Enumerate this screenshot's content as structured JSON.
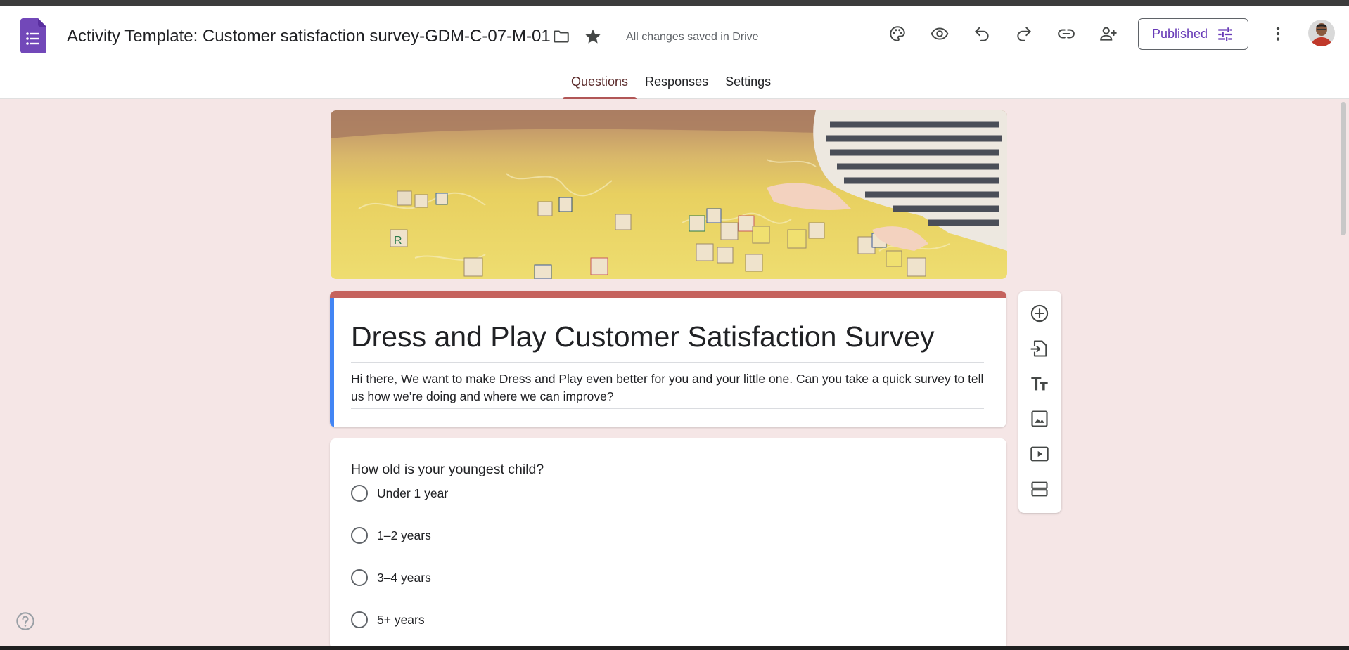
{
  "app": {
    "title": "Activity Template: Customer satisfaction survey-GDM-C-07-M-01",
    "saved_status": "All changes saved in Drive",
    "published_label": "Published"
  },
  "tabs": [
    {
      "label": "Questions",
      "active": true
    },
    {
      "label": "Responses",
      "active": false
    },
    {
      "label": "Settings",
      "active": false
    }
  ],
  "form": {
    "title": "Dress and Play Customer Satisfaction Survey",
    "description": "Hi there, We want to make Dress and Play even better for you and your little one. Can you take a quick survey to tell us how we’re doing and where we can improve?"
  },
  "question": {
    "text": "How old is your youngest child?",
    "options": [
      "Under 1 year",
      "1–2 years",
      "3–4 years",
      "5+ years"
    ]
  },
  "colors": {
    "accent": "#673ab7",
    "theme_top": "#c5625d",
    "theme_left": "#4285f4",
    "background": "#f5e6e6"
  },
  "icons": {
    "header": [
      "forms-logo-icon",
      "folder-icon",
      "star-icon",
      "palette-icon",
      "eye-icon",
      "undo-icon",
      "redo-icon",
      "link-icon",
      "add-person-icon",
      "tune-icon",
      "more-vert-icon"
    ],
    "toolbar": [
      "add-question-icon",
      "import-questions-icon",
      "add-title-icon",
      "add-image-icon",
      "add-video-icon",
      "add-section-icon"
    ]
  }
}
